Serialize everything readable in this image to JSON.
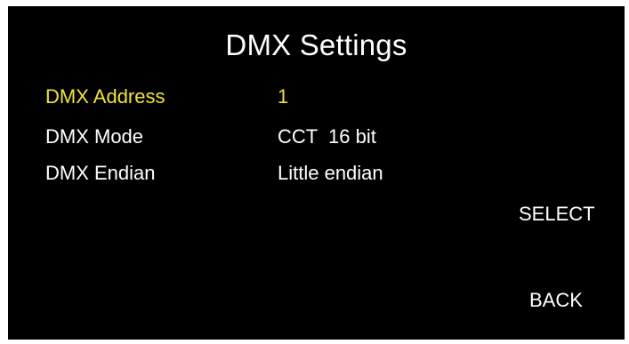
{
  "screen": {
    "title": "DMX Settings",
    "selected_color": "#f2e23b",
    "text_color": "#ffffff",
    "background_color": "#000000"
  },
  "settings": [
    {
      "label": "DMX Address",
      "value": "1",
      "selected": true
    },
    {
      "label": "DMX Mode",
      "value": "CCT  16 bit",
      "selected": false
    },
    {
      "label": "DMX Endian",
      "value": "Little endian",
      "selected": false
    }
  ],
  "softkeys": {
    "select_label": "SELECT",
    "back_label": "BACK"
  }
}
